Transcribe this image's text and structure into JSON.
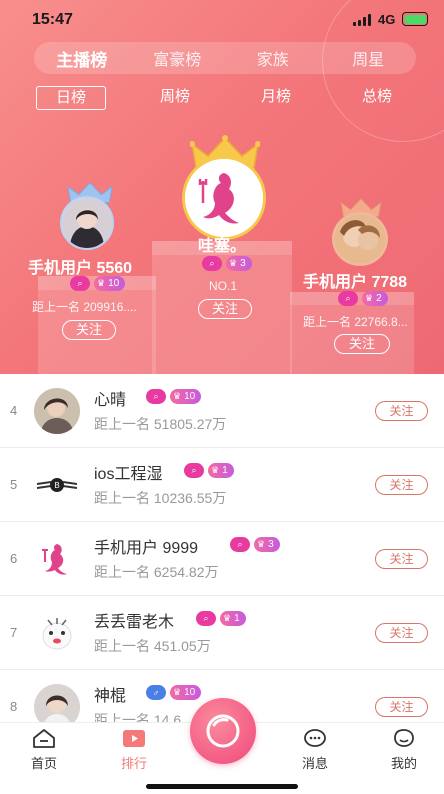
{
  "status_bar": {
    "time": "15:47",
    "network": "4G"
  },
  "board_tabs": [
    "主播榜",
    "富豪榜",
    "家族",
    "周星"
  ],
  "period_tabs": [
    "日榜",
    "周榜",
    "月榜",
    "总榜"
  ],
  "podium": {
    "first": {
      "name": "哇塞。",
      "chat_badge": "⌕",
      "level": "3",
      "note": "NO.1",
      "follow": "关注"
    },
    "second": {
      "name": "手机用户 5560",
      "chat_badge": "⌕",
      "level": "10",
      "gap": "距上一名 209916....",
      "follow": "关注"
    },
    "third": {
      "name": "手机用户 7788",
      "chat_badge": "⌕",
      "level": "2",
      "gap": "距上一名 22766.8...",
      "follow": "关注"
    }
  },
  "rows": [
    {
      "rank": "4",
      "name": "心晴",
      "level": "10",
      "gap": "距上一名 51805.27万",
      "follow": "关注"
    },
    {
      "rank": "5",
      "name": "ios工程湿",
      "level": "1",
      "gap": "距上一名 10236.55万",
      "follow": "关注"
    },
    {
      "rank": "6",
      "name": "手机用户 9999",
      "level": "3",
      "gap": "距上一名 6254.82万",
      "follow": "关注"
    },
    {
      "rank": "7",
      "name": "丢丢雷老木",
      "level": "1",
      "gap": "距上一名 451.05万",
      "follow": "关注"
    },
    {
      "rank": "8",
      "name": "神棍",
      "level": "10",
      "gap": "距上一名 14.6",
      "follow": "关注"
    }
  ],
  "tabbar": {
    "home": "首页",
    "rank": "排行",
    "messages": "消息",
    "mine": "我的"
  },
  "colors": {
    "hero_start": "#f88f8d",
    "hero_end": "#ee6a73",
    "accent": "#f47a7a",
    "follow_border": "#d9756a",
    "chat_badge": "#e83aa0"
  }
}
